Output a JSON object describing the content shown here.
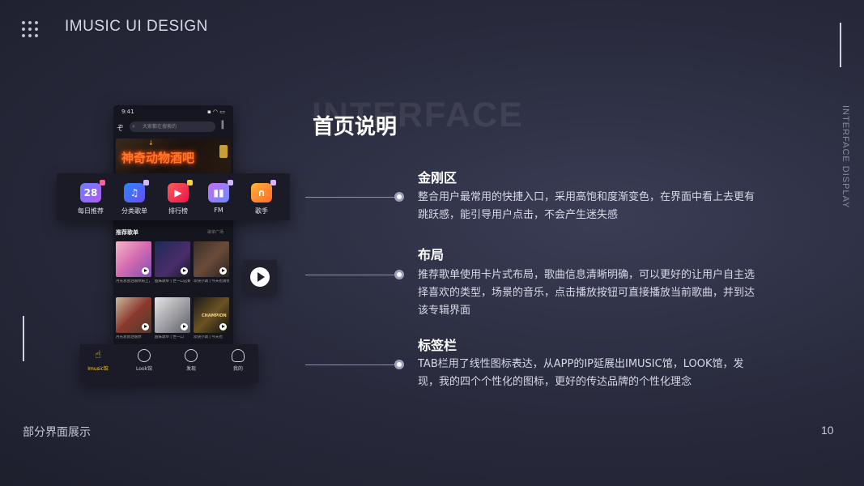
{
  "header": {
    "title": "IMUSIC UI DESIGN"
  },
  "side_label": "INTERFACE DISPLAY",
  "bg_word": "INTERFACE",
  "heading": "首页说明",
  "sections": [
    {
      "title": "金刚区",
      "desc": "整合用户最常用的快捷入口，采用高饱和度渐变色，在界面中看上去更有跳跃感，能引导用户点击，不会产生迷失感"
    },
    {
      "title": "布局",
      "desc": "推荐歌单使用卡片式布局，歌曲信息清晰明确，可以更好的让用户自主选择喜欢的类型，场景的音乐，点击播放按钮可直接播放当前歌曲，并到达该专辑界面"
    },
    {
      "title": "标签栏",
      "desc": "TAB栏用了线性图标表达，从APP的IP延展出IMUSIC馆，LOOK馆，发现，我的四个个性化的图标，更好的传达品牌的个性化理念"
    }
  ],
  "footer": {
    "label": "部分界面展示",
    "page": "10"
  },
  "phone": {
    "time": "9:41",
    "search_placeholder": "大家都在搜索的",
    "banner_text": "神奇动物酒吧",
    "section_title": "推荐歌单",
    "section_more": "歌单广场",
    "cards": [
      {
        "text": "月光总会洒落你肩上，今晚合唱…"
      },
      {
        "text": "甜妹歌单 | 世一口这颗夏天的气泡…"
      },
      {
        "text": "欢快小调 | 今天也请你务必要开心…"
      },
      {
        "text": "月光总会洒落你"
      },
      {
        "text": "甜妹歌单 | 世一口"
      },
      {
        "text": "欢快小调 | 今天也"
      }
    ],
    "card3_overlay": "CHAMPION"
  },
  "quick_entries": [
    {
      "label": "每日推荐",
      "icon": "calendar-icon",
      "num": "28",
      "color": "#8a5cf6"
    },
    {
      "label": "分类歌单",
      "icon": "playlist-icon",
      "color": "#3b6cf0"
    },
    {
      "label": "排行榜",
      "icon": "video-icon",
      "color": "#f0364a"
    },
    {
      "label": "FM",
      "icon": "bars-icon",
      "color": "#a06cf2"
    },
    {
      "label": "歌手",
      "icon": "headphones-icon",
      "color": "#f08a2a"
    }
  ],
  "tabs": [
    {
      "label": "Imusic馆",
      "active": true
    },
    {
      "label": "Look馆"
    },
    {
      "label": "发现"
    },
    {
      "label": "我的"
    }
  ],
  "colors": {
    "accent": "#ffd23a",
    "bg": "#2a2c3f"
  }
}
